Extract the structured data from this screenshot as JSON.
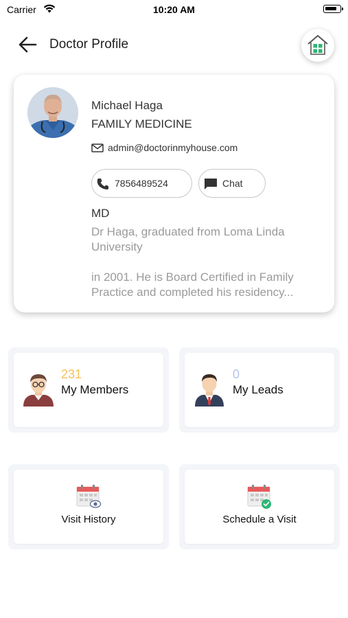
{
  "status_bar": {
    "carrier": "Carrier",
    "time": "10:20 AM"
  },
  "header": {
    "title": "Doctor Profile",
    "back_icon": "arrow-left-icon",
    "home_icon": "home-icon"
  },
  "profile": {
    "name": "Michael Haga",
    "specialty": "FAMILY MEDICINE",
    "email": "admin@doctorinmyhouse.com",
    "phone": "7856489524",
    "chat_label": "Chat",
    "degree": "MD",
    "bio_line1": "Dr Haga, graduated from Loma Linda University",
    "bio_line2": "in 2001. He is Board Certified in Family Practice and completed his residency..."
  },
  "stats": [
    {
      "count": "231",
      "label": "My Members",
      "count_color": "#f3c25a"
    },
    {
      "count": "0",
      "label": "My Leads",
      "count_color": "#b9c3ea"
    }
  ],
  "actions": [
    {
      "label": "Visit History",
      "icon": "calendar-eye-icon"
    },
    {
      "label": "Schedule a Visit",
      "icon": "calendar-check-icon"
    }
  ],
  "colors": {
    "accent_green": "#2bb673",
    "calendar_red": "#e85a5a"
  }
}
